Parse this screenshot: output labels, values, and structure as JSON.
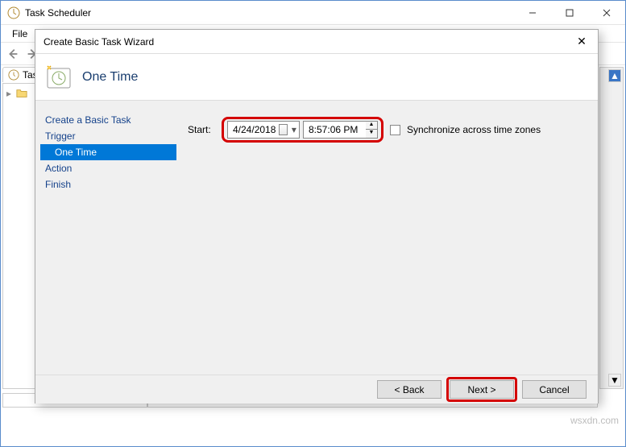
{
  "main_window": {
    "title": "Task Scheduler",
    "menu": {
      "file": "File"
    },
    "tree_tab": "Tas",
    "watermark": "wsxdn.com"
  },
  "wizard": {
    "title": "Create Basic Task Wizard",
    "header": "One Time",
    "nav": {
      "create": "Create a Basic Task",
      "trigger": "Trigger",
      "onetime": "One Time",
      "action": "Action",
      "finish": "Finish"
    },
    "content": {
      "start_label": "Start:",
      "date": "4/24/2018",
      "time": "8:57:06 PM",
      "sync_label": "Synchronize across time zones"
    },
    "footer": {
      "back": "< Back",
      "next": "Next >",
      "cancel": "Cancel"
    }
  }
}
